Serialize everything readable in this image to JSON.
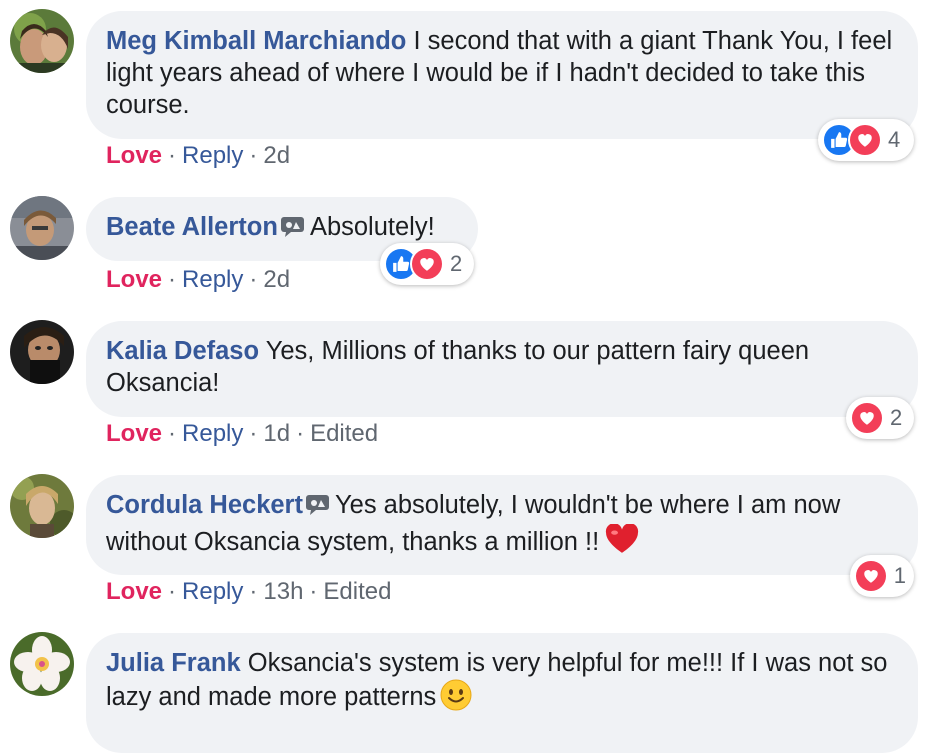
{
  "comments": [
    {
      "author": "Meg Kimball Marchiando",
      "text": "I second that with a giant Thank You, I feel light years ahead of where I would be if I hadn't decided to take this course.",
      "actions": {
        "love": "Love",
        "reply": "Reply",
        "time": "2d",
        "edited": ""
      },
      "reactions": {
        "types": [
          "like",
          "love"
        ],
        "count": "4"
      }
    },
    {
      "author": "Beate Allerton",
      "text": "Absolutely!",
      "actions": {
        "love": "Love",
        "reply": "Reply",
        "time": "2d",
        "edited": ""
      },
      "reactions": {
        "types": [
          "like",
          "love"
        ],
        "count": "2"
      }
    },
    {
      "author": "Kalia Defaso",
      "text": "Yes, Millions of thanks to our pattern fairy queen Oksancia!",
      "actions": {
        "love": "Love",
        "reply": "Reply",
        "time": "1d",
        "edited": "Edited"
      },
      "reactions": {
        "types": [
          "love"
        ],
        "count": "2"
      }
    },
    {
      "author": "Cordula Heckert",
      "text": "Yes absolutely, I wouldn't be where I am now without Oksancia system, thanks a million !!",
      "actions": {
        "love": "Love",
        "reply": "Reply",
        "time": "13h",
        "edited": "Edited"
      },
      "reactions": {
        "types": [
          "love"
        ],
        "count": "1"
      }
    },
    {
      "author": "Julia Frank",
      "text": "Oksancia's system is very helpful for me!!! If I was not so lazy and made more patterns",
      "actions": {
        "love": "Love",
        "reply": "Reply",
        "time": "",
        "edited": ""
      },
      "reactions": {
        "types": [],
        "count": ""
      }
    }
  ],
  "separator": "·",
  "icons": {
    "verified": "speech-bubble-badge-icon",
    "like": "thumbs-up-icon",
    "love": "heart-icon",
    "heart_emoji": "red-heart-emoji-icon",
    "smile_emoji": "slightly-smiling-face-emoji-icon"
  },
  "colors": {
    "author": "#365899",
    "love_action": "#e0245e",
    "meta": "#606770",
    "bubble": "#f0f2f5",
    "like": "#1877f2",
    "love": "#f33e58"
  }
}
